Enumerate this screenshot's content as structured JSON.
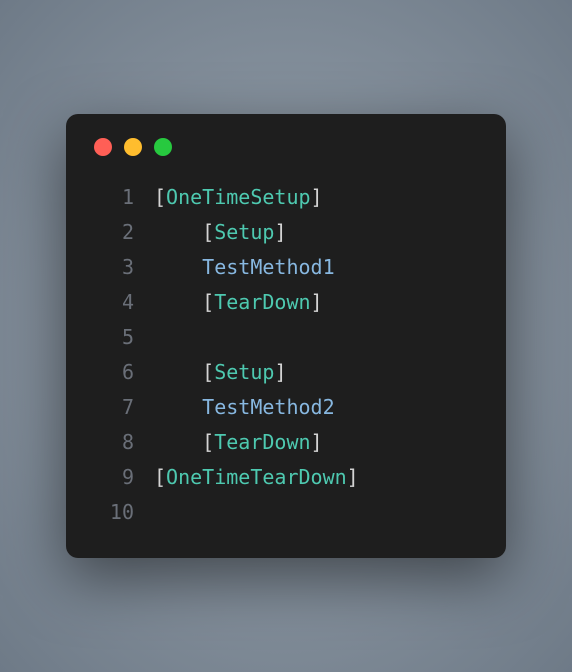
{
  "window": {
    "dots": {
      "close": "#ff5f56",
      "minimize": "#ffbd2e",
      "maximize": "#27c93f"
    }
  },
  "code": {
    "lines": [
      {
        "n": "1",
        "indent": "",
        "type": "attr",
        "text": "OneTimeSetup"
      },
      {
        "n": "2",
        "indent": "    ",
        "type": "attr",
        "text": "Setup"
      },
      {
        "n": "3",
        "indent": "    ",
        "type": "method",
        "text": "TestMethod1"
      },
      {
        "n": "4",
        "indent": "    ",
        "type": "attr",
        "text": "TearDown"
      },
      {
        "n": "5",
        "indent": "",
        "type": "blank",
        "text": ""
      },
      {
        "n": "6",
        "indent": "    ",
        "type": "attr",
        "text": "Setup"
      },
      {
        "n": "7",
        "indent": "    ",
        "type": "method",
        "text": "TestMethod2"
      },
      {
        "n": "8",
        "indent": "    ",
        "type": "attr",
        "text": "TearDown"
      },
      {
        "n": "9",
        "indent": "",
        "type": "attr",
        "text": "OneTimeTearDown"
      },
      {
        "n": "10",
        "indent": "",
        "type": "blank",
        "text": ""
      }
    ]
  }
}
